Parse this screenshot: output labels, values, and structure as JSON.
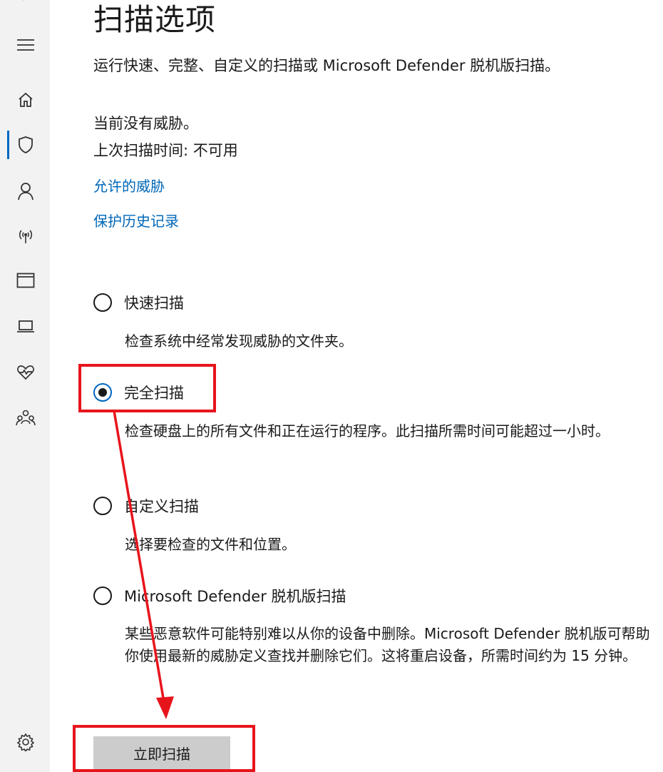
{
  "window": {
    "back_glyph": "‹"
  },
  "sidebar": {
    "items": [
      {
        "name": "menu",
        "icon": "hamburger-menu-icon"
      },
      {
        "name": "home",
        "icon": "home-icon"
      },
      {
        "name": "virus-protection",
        "icon": "shield-icon",
        "active": true
      },
      {
        "name": "account-protection",
        "icon": "person-icon"
      },
      {
        "name": "firewall-network",
        "icon": "wifi-antenna-icon"
      },
      {
        "name": "app-browser-control",
        "icon": "browser-window-icon"
      },
      {
        "name": "device-security",
        "icon": "laptop-icon"
      },
      {
        "name": "device-performance",
        "icon": "heart-pulse-icon"
      },
      {
        "name": "family-options",
        "icon": "family-icon"
      },
      {
        "name": "settings",
        "icon": "gear-icon"
      }
    ],
    "accent_color": "#0067c0"
  },
  "page": {
    "title": "扫描选项",
    "subtitle": "运行快速、完整、自定义的扫描或 Microsoft Defender 脱机版扫描。",
    "status_threats": "当前没有威胁。",
    "status_last_scan": "上次扫描时间: 不可用",
    "link_allowed_threats": "允许的威胁",
    "link_protection_history": "保护历史记录",
    "link_color": "#0067b8"
  },
  "scan_options": [
    {
      "label": "快速扫描",
      "description": "检查系统中经常发现威胁的文件夹。",
      "selected": false
    },
    {
      "label": "完全扫描",
      "description": "检查硬盘上的所有文件和正在运行的程序。此扫描所需时间可能超过一小时。",
      "selected": true
    },
    {
      "label": "自定义扫描",
      "description": "选择要检查的文件和位置。",
      "selected": false
    },
    {
      "label": "Microsoft Defender 脱机版扫描",
      "description": "某些恶意软件可能特别难以从你的设备中删除。Microsoft Defender 脱机版可帮助你使用最新的威胁定义查找并删除它们。这将重启设备，所需时间约为 15 分钟。",
      "selected": false
    }
  ],
  "actions": {
    "scan_now_label": "立即扫描",
    "button_color": "#cccccc"
  },
  "annotation": {
    "highlight_color": "#e8141c"
  }
}
